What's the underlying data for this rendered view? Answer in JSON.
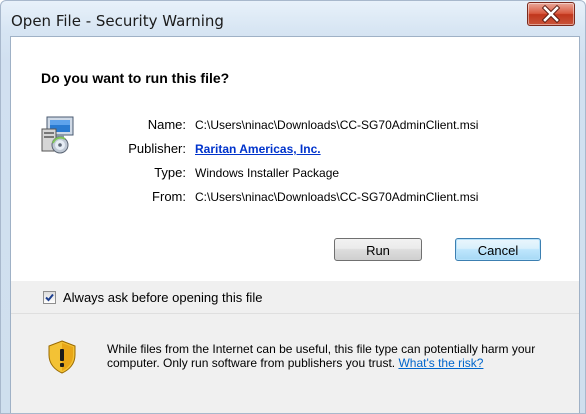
{
  "window": {
    "title": "Open File - Security Warning"
  },
  "dialog": {
    "heading": "Do you want to run this file?",
    "info": [
      {
        "label": "Name:",
        "value": "C:\\Users\\ninac\\Downloads\\CC-SG70AdminClient.msi"
      },
      {
        "label": "Publisher:",
        "value": "Raritan Americas, Inc."
      },
      {
        "label": "Type:",
        "value": "Windows Installer Package"
      },
      {
        "label": "From:",
        "value": "C:\\Users\\ninac\\Downloads\\CC-SG70AdminClient.msi"
      }
    ],
    "buttons": {
      "run": "Run",
      "cancel": "Cancel"
    },
    "always_ask": {
      "label": "Always ask before opening this file",
      "checked": true
    },
    "warning": {
      "text": "While files from the Internet can be useful, this file type can potentially harm your computer. Only run software from publishers you trust. ",
      "link": "What's the risk?"
    }
  },
  "icons": {
    "close": "close-icon",
    "file": "installer-package-icon",
    "checkbox": "checkmark-icon",
    "warning": "shield-warning-icon"
  },
  "colors": {
    "link": "#0033cc",
    "close_button": "#c9553b",
    "default_button_border": "#3c7fb1"
  }
}
